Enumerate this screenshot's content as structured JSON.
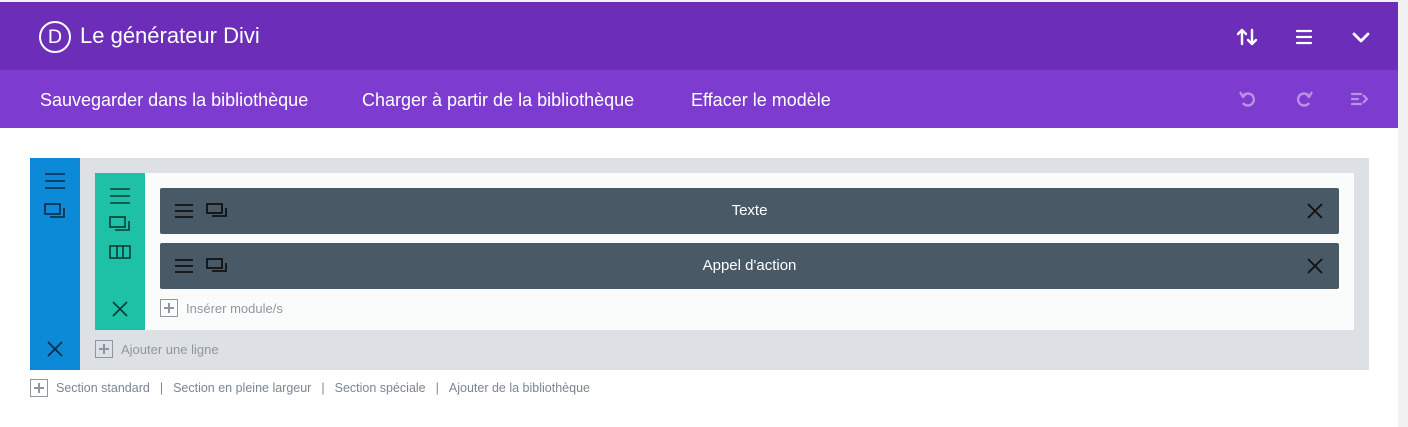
{
  "header": {
    "logo_letter": "D",
    "title": "Le générateur Divi",
    "icons": [
      "sort-arrows-icon",
      "hamburger-menu-icon",
      "chevron-down-icon"
    ]
  },
  "toolbar": {
    "save_label": "Sauvegarder dans la bibliothèque",
    "load_label": "Charger à partir de la bibliothèque",
    "clear_label": "Effacer le modèle",
    "icons": [
      "undo-icon",
      "redo-icon",
      "history-icon"
    ]
  },
  "builder": {
    "modules": [
      {
        "title": "Texte"
      },
      {
        "title": "Appel d'action"
      }
    ],
    "insert_module_label": "Insérer module/s",
    "add_row_label": "Ajouter une ligne"
  },
  "footer": {
    "links": [
      "Section standard",
      "Section en pleine largeur",
      "Section spéciale",
      "Ajouter de la bibliothèque"
    ],
    "separator": "|"
  },
  "colors": {
    "topbar": "#6c2eb9",
    "secondary_bar": "#7e3bd0",
    "section_handle": "#0c8ad8",
    "row_handle": "#1fc1a6",
    "module_bg": "#4a5966",
    "section_bg": "#dde0e5"
  }
}
